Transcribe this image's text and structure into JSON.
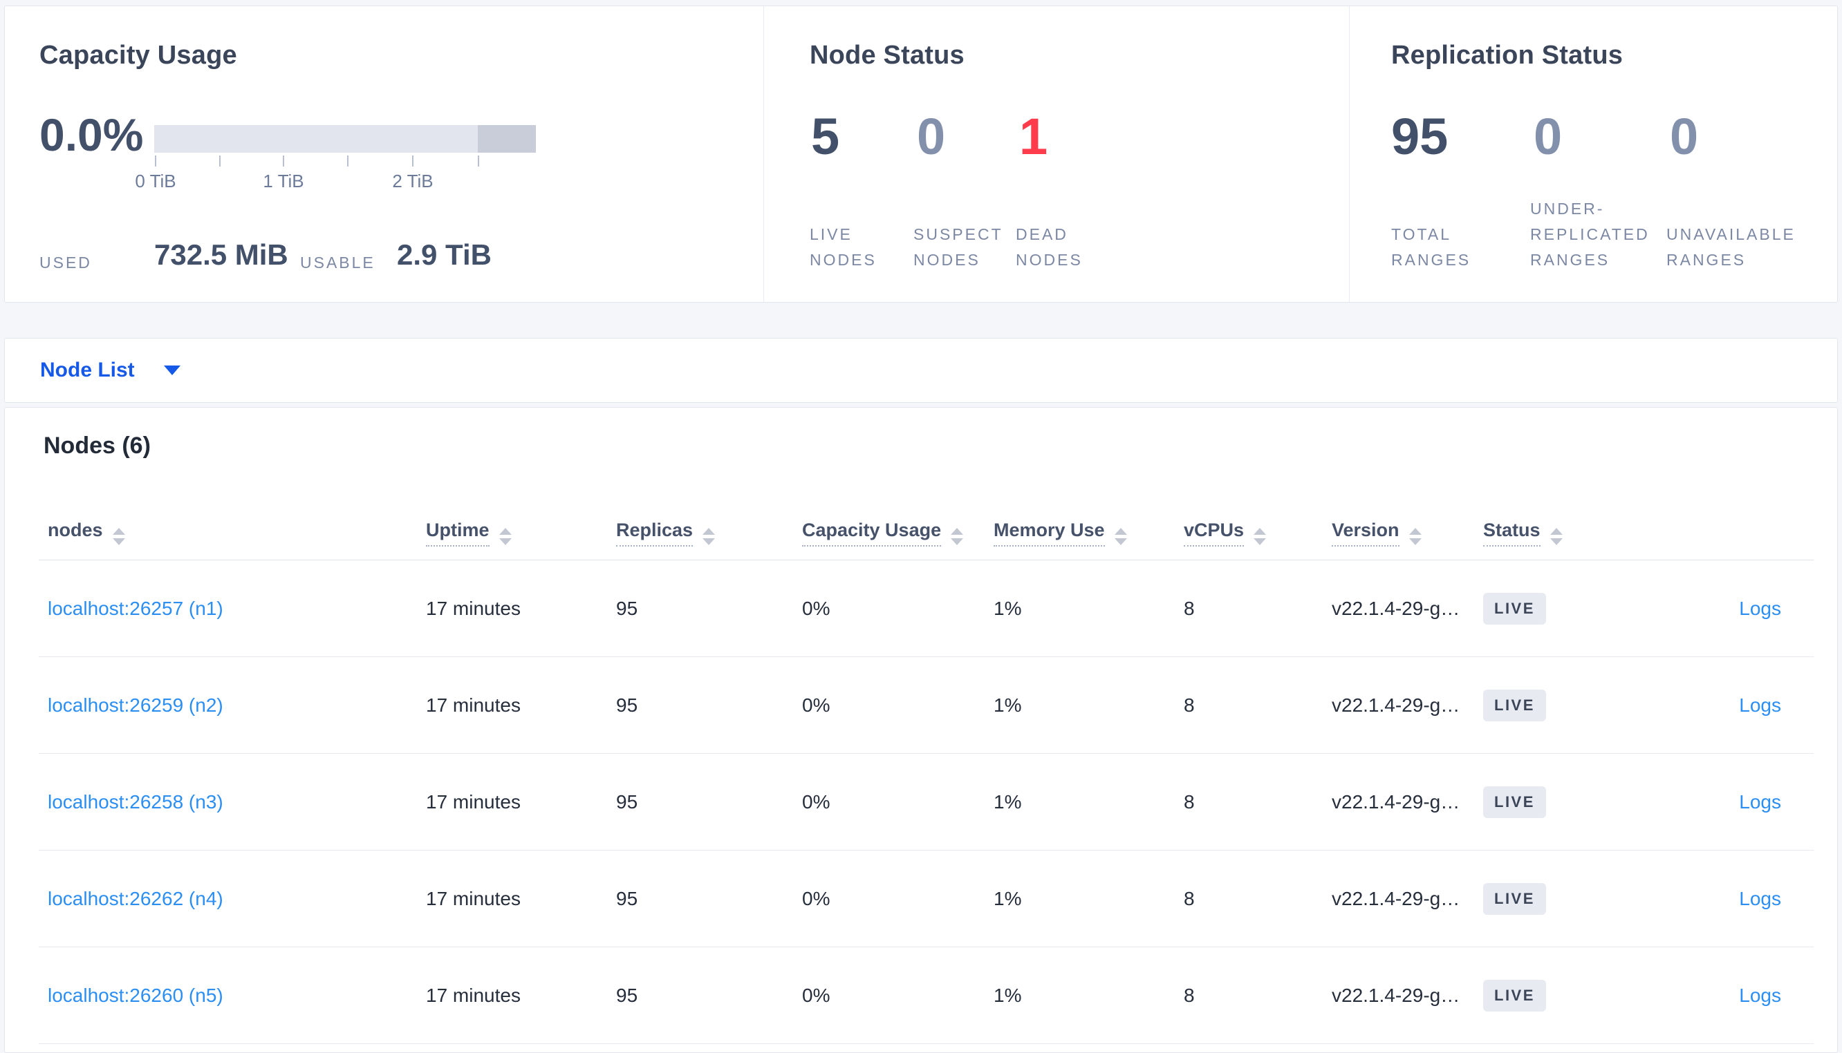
{
  "summary": {
    "capacity": {
      "title": "Capacity Usage",
      "percent": "0.0%",
      "tick_labels": [
        "0 TiB",
        "1 TiB",
        "2 TiB"
      ],
      "used_label": "USED",
      "used_value": "732.5 MiB",
      "usable_label": "USABLE",
      "usable_value": "2.9 TiB"
    },
    "node_status": {
      "title": "Node Status",
      "stats": [
        {
          "value": "5",
          "tone": "dark",
          "label_lines": [
            "LIVE",
            "NODES"
          ]
        },
        {
          "value": "0",
          "tone": "muted",
          "label_lines": [
            "SUSPECT",
            "NODES"
          ]
        },
        {
          "value": "1",
          "tone": "danger",
          "label_lines": [
            "DEAD",
            "NODES"
          ]
        }
      ]
    },
    "replication_status": {
      "title": "Replication Status",
      "stats": [
        {
          "value": "95",
          "tone": "dark",
          "label_lines": [
            "TOTAL",
            "RANGES"
          ]
        },
        {
          "value": "0",
          "tone": "muted",
          "label_lines": [
            "UNDER-",
            "REPLICATED",
            "RANGES"
          ]
        },
        {
          "value": "0",
          "tone": "muted",
          "label_lines": [
            "UNAVAILABLE",
            "RANGES"
          ]
        }
      ]
    }
  },
  "view_selector": {
    "label": "Node List"
  },
  "nodes_section": {
    "title": "Nodes (6)",
    "columns": [
      {
        "key": "node",
        "label": "nodes",
        "underline": false
      },
      {
        "key": "uptime",
        "label": "Uptime",
        "underline": true
      },
      {
        "key": "replicas",
        "label": "Replicas",
        "underline": true
      },
      {
        "key": "capacity_usage",
        "label": "Capacity Usage",
        "underline": true
      },
      {
        "key": "memory_use",
        "label": "Memory Use",
        "underline": true
      },
      {
        "key": "vcpus",
        "label": "vCPUs",
        "underline": true
      },
      {
        "key": "version",
        "label": "Version",
        "underline": true
      },
      {
        "key": "status",
        "label": "Status",
        "underline": true
      }
    ],
    "rows": [
      {
        "node": "localhost:26257 (n1)",
        "uptime": "17 minutes",
        "replicas": "95",
        "capacity_usage": "0%",
        "memory_use": "1%",
        "vcpus": "8",
        "version": "v22.1.4-29-g…",
        "status": "LIVE",
        "logs": "Logs"
      },
      {
        "node": "localhost:26259 (n2)",
        "uptime": "17 minutes",
        "replicas": "95",
        "capacity_usage": "0%",
        "memory_use": "1%",
        "vcpus": "8",
        "version": "v22.1.4-29-g…",
        "status": "LIVE",
        "logs": "Logs"
      },
      {
        "node": "localhost:26258 (n3)",
        "uptime": "17 minutes",
        "replicas": "95",
        "capacity_usage": "0%",
        "memory_use": "1%",
        "vcpus": "8",
        "version": "v22.1.4-29-g…",
        "status": "LIVE",
        "logs": "Logs"
      },
      {
        "node": "localhost:26262 (n4)",
        "uptime": "17 minutes",
        "replicas": "95",
        "capacity_usage": "0%",
        "memory_use": "1%",
        "vcpus": "8",
        "version": "v22.1.4-29-g…",
        "status": "LIVE",
        "logs": "Logs"
      },
      {
        "node": "localhost:26260 (n5)",
        "uptime": "17 minutes",
        "replicas": "95",
        "capacity_usage": "0%",
        "memory_use": "1%",
        "vcpus": "8",
        "version": "v22.1.4-29-g…",
        "status": "LIVE",
        "logs": "Logs"
      }
    ]
  },
  "colors": {
    "page_background": "#f4f6fa",
    "card_border": "#e3e6ee",
    "title_text": "#3b4559",
    "stat_dark": "#42506a",
    "stat_muted": "#8390ac",
    "stat_danger": "#ff3b4c",
    "label_gray": "#7c88a3",
    "bar_light": "#e3e5ee",
    "bar_dark": "#c9cdd9",
    "selector_blue": "#1659e8",
    "link_blue": "#2b8ef2",
    "table_text": "#262d3b",
    "header_text": "#46516a",
    "badge_background": "#e8eaf1"
  }
}
